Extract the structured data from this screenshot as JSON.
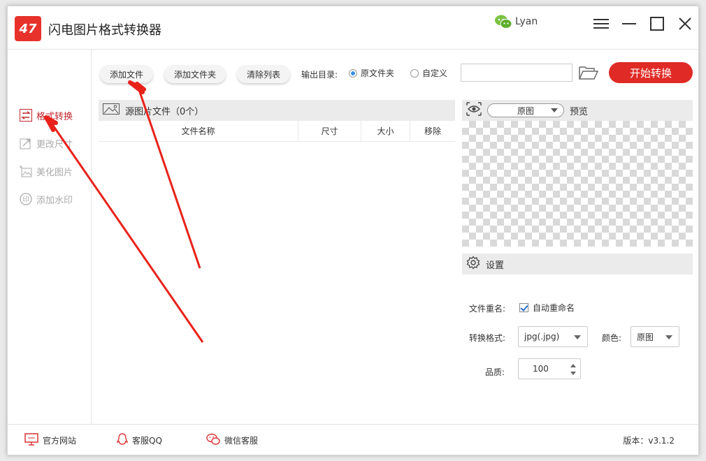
{
  "app": {
    "title": "闪电图片格式转换器",
    "user_name": "Lyan",
    "logo_text": "47"
  },
  "sidebar": {
    "items": [
      {
        "label": "格式转换",
        "active": true
      },
      {
        "label": "更改尺寸",
        "active": false
      },
      {
        "label": "美化图片",
        "active": false
      },
      {
        "label": "添加水印",
        "active": false
      }
    ]
  },
  "toolbar": {
    "add_file": "添加文件",
    "add_folder": "添加文件夹",
    "clear_list": "清除列表",
    "output_label": "输出目录:",
    "radio_original": "原文件夹",
    "radio_custom": "自定义",
    "path_value": "",
    "start_label": "开始转换"
  },
  "file_panel": {
    "header": "源图片文件（0个）",
    "columns": [
      "文件名称",
      "尺寸",
      "大小",
      "移除"
    ]
  },
  "preview": {
    "select_value": "原图",
    "label": "预览"
  },
  "settings": {
    "header": "设置",
    "rename_label": "文件重名:",
    "rename_option": "自动重命名",
    "format_label": "转换格式:",
    "format_value": "jpg(.jpg)",
    "color_label": "颜色:",
    "color_value": "原图",
    "quality_label": "品质:",
    "quality_value": "100"
  },
  "footer": {
    "website": "官方网站",
    "qq": "客服QQ",
    "wechat": "微信客服",
    "version": "版本：v3.1.2"
  },
  "colors": {
    "accent": "#e02a25",
    "active_text": "#c0262d",
    "annotation_arrow": "#e8221b"
  }
}
